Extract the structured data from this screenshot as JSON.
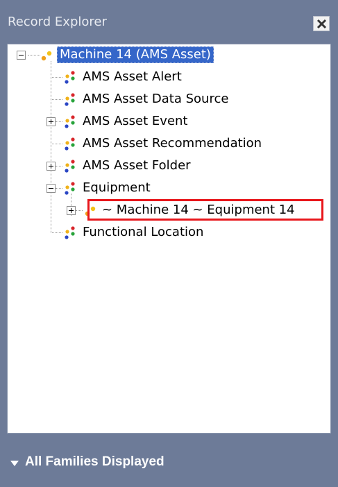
{
  "panel": {
    "title": "Record Explorer",
    "close_label": "×"
  },
  "tree": {
    "root": {
      "label": "Machine 14 (AMS Asset)",
      "icon": "family-record-icon",
      "expanded": true,
      "selected": true
    },
    "children": [
      {
        "label": "AMS Asset Alert",
        "icon": "family-icon",
        "expander": "none"
      },
      {
        "label": "AMS Asset Data Source",
        "icon": "family-icon",
        "expander": "none"
      },
      {
        "label": "AMS Asset Event",
        "icon": "family-icon",
        "expander": "plus"
      },
      {
        "label": "AMS Asset Recommendation",
        "icon": "family-icon",
        "expander": "none"
      },
      {
        "label": "AMS Asset Folder",
        "icon": "family-icon",
        "expander": "plus"
      },
      {
        "label": "Equipment",
        "icon": "family-icon",
        "expander": "minus",
        "children": [
          {
            "label": "~ Machine 14 ~ Equipment 14",
            "icon": "record-icon",
            "expander": "plus",
            "highlighted": true
          }
        ]
      },
      {
        "label": "Functional Location",
        "icon": "family-icon",
        "expander": "none"
      }
    ]
  },
  "footer": {
    "label": "All Families Displayed"
  },
  "colors": {
    "panel_bg": "#6d7b98",
    "selection": "#3566c9",
    "highlight_box": "#e8161b"
  }
}
